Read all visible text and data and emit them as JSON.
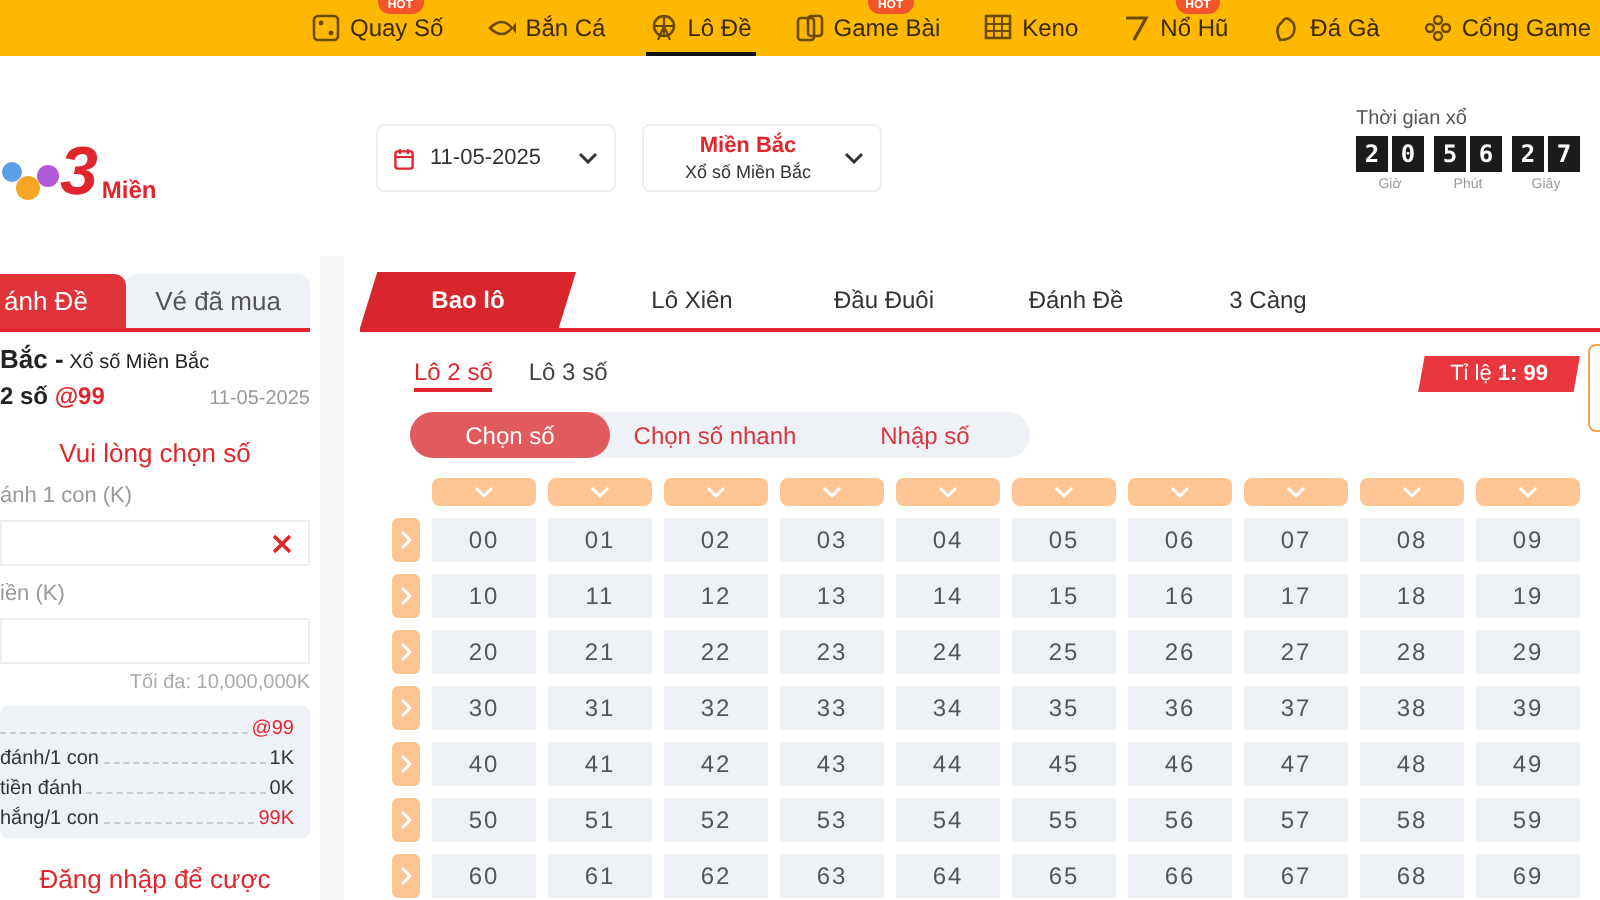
{
  "nav": {
    "items": [
      {
        "label": "Quay Số",
        "badge": "HOT",
        "selected": false
      },
      {
        "label": "Bắn Cá",
        "selected": false
      },
      {
        "label": "Lô Đề",
        "selected": true
      },
      {
        "label": "Game Bài",
        "badge": "HOT",
        "selected": false
      },
      {
        "label": "Keno",
        "selected": false
      },
      {
        "label": "Nổ Hũ",
        "badge": "HOT",
        "selected": false
      },
      {
        "label": "Đá Gà",
        "selected": false
      },
      {
        "label": "Cổng Game",
        "selected": false
      }
    ]
  },
  "header": {
    "logo": {
      "number": "3",
      "text": "Miền"
    },
    "date_picker": {
      "value": "11-05-2025"
    },
    "region_picker": {
      "title": "Miền Bắc",
      "subtitle": "Xổ số Miền Bắc"
    },
    "countdown": {
      "label": "Thời gian xổ",
      "groups": [
        {
          "digits": [
            "2",
            "0"
          ],
          "unit": "Giờ"
        },
        {
          "digits": [
            "5",
            "6"
          ],
          "unit": "Phút"
        },
        {
          "digits": [
            "2",
            "7"
          ],
          "unit": "Giây"
        }
      ]
    }
  },
  "bet_slip": {
    "tabs": [
      {
        "label": "ánh Đề",
        "selected": true
      },
      {
        "label": "Vé đã mua",
        "selected": false
      }
    ],
    "title": "**Bắc -** Xổ số Miền Bắc",
    "bet_type": "2 số",
    "odds": "@99",
    "date": "11-05-2025",
    "message": "Vui lòng chọn số",
    "fields": [
      {
        "label": "ánh 1 con (K)",
        "clearable": true
      },
      {
        "label": "iền (K)",
        "clearable": false
      }
    ],
    "max_note": "Tối đa: 10,000,000K",
    "summary": [
      {
        "value": "@99",
        "highlight": true
      },
      {
        "label": "đánh/1 con",
        "value": "1K",
        "highlight": false
      },
      {
        "label": "tiền đánh",
        "value": "0K",
        "highlight": false
      },
      {
        "label": "hắng/1 con",
        "value": "99K",
        "highlight": true
      }
    ],
    "login_link": "Đăng nhập để cược"
  },
  "board": {
    "game_tabs": [
      {
        "label": "Bao lô",
        "selected": true
      },
      {
        "label": "Lô Xiên",
        "selected": false
      },
      {
        "label": "Đầu Đuôi",
        "selected": false
      },
      {
        "label": "Đánh Đề",
        "selected": false
      },
      {
        "label": "3 Càng",
        "selected": false
      }
    ],
    "sub_tabs": [
      {
        "label": "Lô 2 số",
        "selected": true
      },
      {
        "label": "Lô 3 số",
        "selected": false
      }
    ],
    "rate": "Tỉ lệ **1: 99**",
    "modes": [
      {
        "label": "Chọn số",
        "selected": true
      },
      {
        "label": "Chọn số nhanh",
        "selected": false
      },
      {
        "label": "Nhập số",
        "selected": false
      }
    ],
    "numbers": [
      [
        "00",
        "01",
        "02",
        "03",
        "04",
        "05",
        "06",
        "07",
        "08",
        "09"
      ],
      [
        "10",
        "11",
        "12",
        "13",
        "14",
        "15",
        "16",
        "17",
        "18",
        "19"
      ],
      [
        "20",
        "21",
        "22",
        "23",
        "24",
        "25",
        "26",
        "27",
        "28",
        "29"
      ],
      [
        "30",
        "31",
        "32",
        "33",
        "34",
        "35",
        "36",
        "37",
        "38",
        "39"
      ],
      [
        "40",
        "41",
        "42",
        "43",
        "44",
        "45",
        "46",
        "47",
        "48",
        "49"
      ],
      [
        "50",
        "51",
        "52",
        "53",
        "54",
        "55",
        "56",
        "57",
        "58",
        "59"
      ],
      [
        "60",
        "61",
        "62",
        "63",
        "64",
        "65",
        "66",
        "67",
        "68",
        "69"
      ]
    ]
  }
}
